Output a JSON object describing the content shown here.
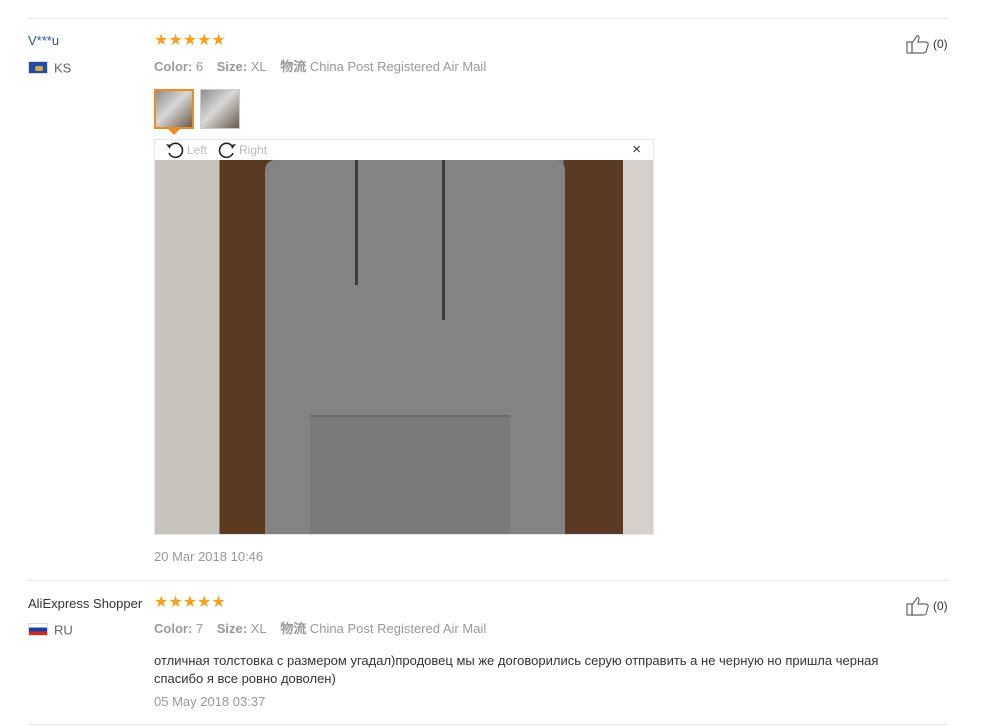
{
  "reviews": [
    {
      "user": "V***u",
      "country": "KS",
      "stars": "★★★★★",
      "color_label": "Color:",
      "color_value": "6",
      "size_label": "Size:",
      "size_value": "XL",
      "shipping_label": "物流",
      "shipping_value": "China Post Registered Air Mail",
      "likes": "(0)",
      "viewer": {
        "left_label": "Left",
        "right_label": "Right",
        "close": "×"
      },
      "date": "20 Mar 2018 10:46"
    },
    {
      "user": "AliExpress Shopper",
      "country": "RU",
      "stars": "★★★★★",
      "color_label": "Color:",
      "color_value": "7",
      "size_label": "Size:",
      "size_value": "XL",
      "shipping_label": "物流",
      "shipping_value": "China Post Registered Air Mail",
      "likes": "(0)",
      "text_line1": "отличная толстовка с размером угадал)продовец мы же договорились серую отправить а не черную но пришла черная",
      "text_line2": "спасибо я все ровно доволен)",
      "date": "05 May 2018 03:37"
    }
  ],
  "colors": {
    "star": "#f7a01f",
    "active_thumb": "#f08a24",
    "link": "#1e5aa8"
  },
  "icons": [
    "thumbs-up-icon",
    "rotate-left-icon",
    "rotate-right-icon",
    "close-icon",
    "flag-ks-icon",
    "flag-ru-icon"
  ]
}
